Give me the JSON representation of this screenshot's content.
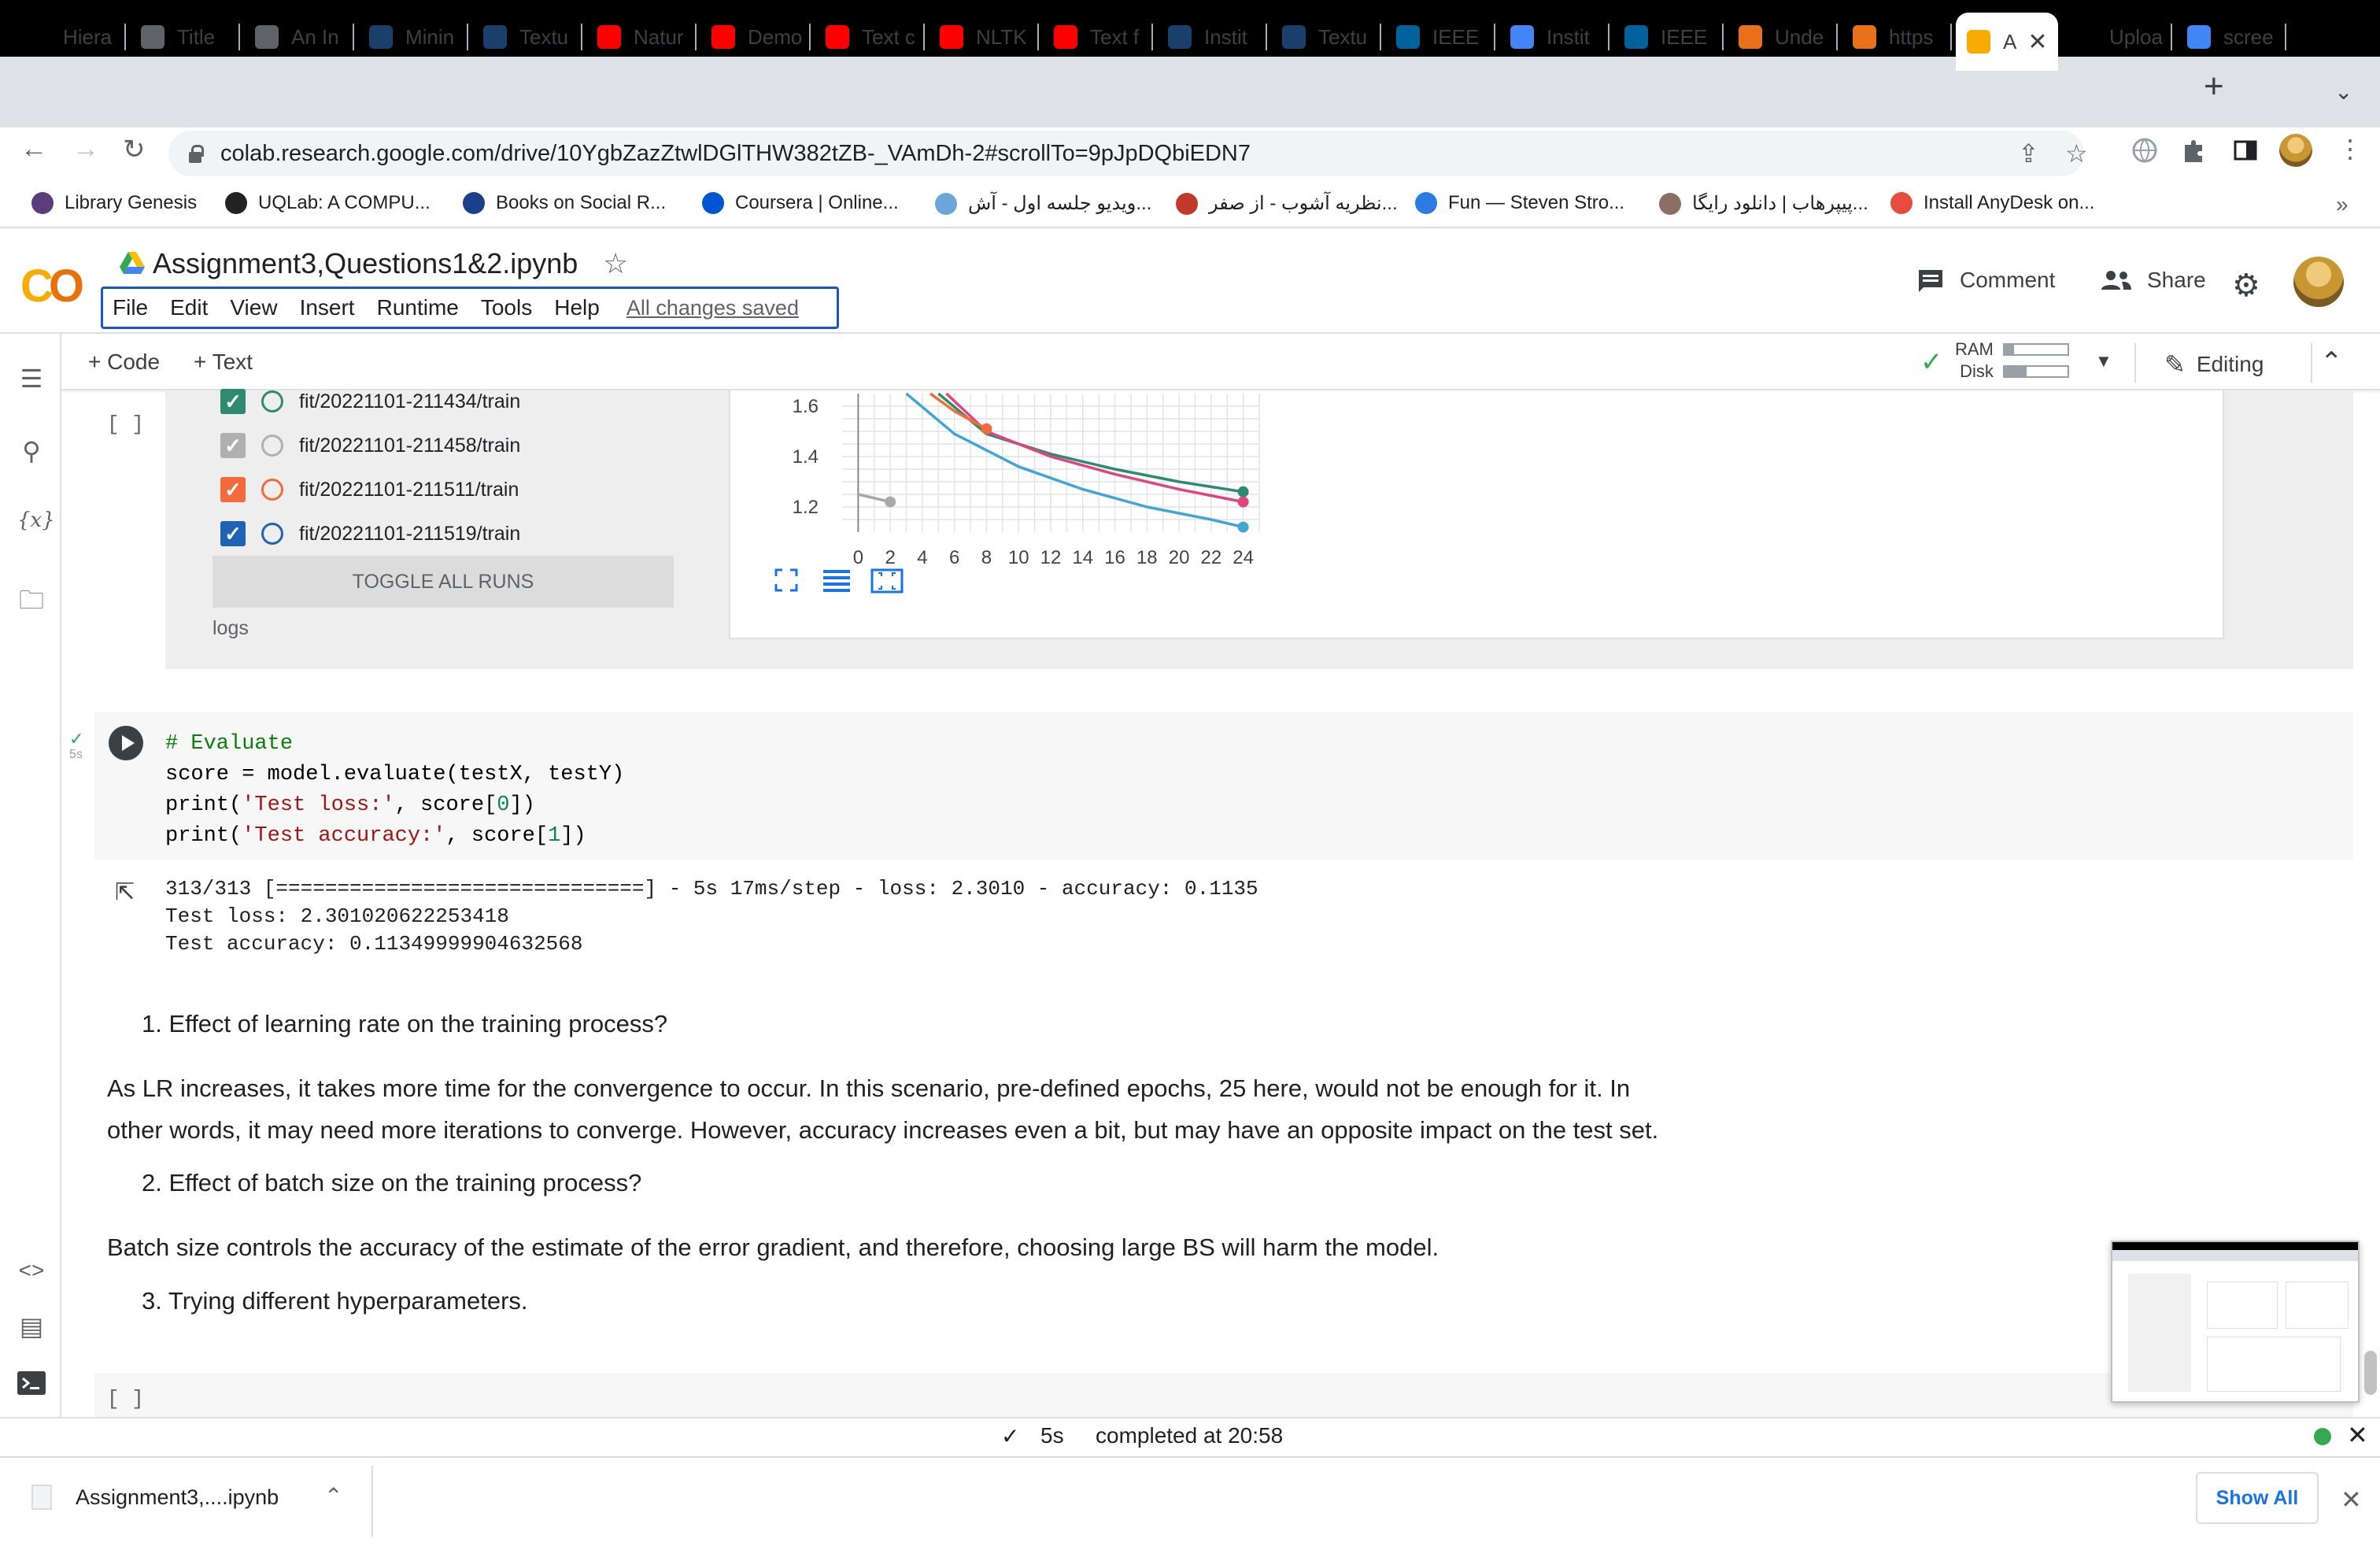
{
  "browser": {
    "tabs": [
      {
        "label": "Hiera",
        "icon": "asu-icon",
        "color": "#000000"
      },
      {
        "label": "Title",
        "icon": "globe-icon",
        "color": "#5f6368"
      },
      {
        "label": "An In",
        "icon": "globe-icon",
        "color": "#5f6368"
      },
      {
        "label": "Minin",
        "icon": "arc-icon",
        "color": "#1b3f6b"
      },
      {
        "label": "Textu",
        "icon": "arc-icon",
        "color": "#1b3f6b"
      },
      {
        "label": "Natur",
        "icon": "youtube-icon",
        "color": "#ff0000"
      },
      {
        "label": "Demo",
        "icon": "youtube-icon",
        "color": "#ff0000"
      },
      {
        "label": "Text c",
        "icon": "youtube-icon",
        "color": "#ff0000"
      },
      {
        "label": "NLTK",
        "icon": "youtube-icon",
        "color": "#ff0000"
      },
      {
        "label": "Text f",
        "icon": "youtube-icon",
        "color": "#ff0000"
      },
      {
        "label": "Instit",
        "icon": "arc-icon",
        "color": "#1b3f6b"
      },
      {
        "label": "Textu",
        "icon": "arc-icon",
        "color": "#1b3f6b"
      },
      {
        "label": "IEEE",
        "icon": "ieee-icon",
        "color": "#00629b"
      },
      {
        "label": "Instit",
        "icon": "chrome-icon",
        "color": "#4285f4"
      },
      {
        "label": "IEEE",
        "icon": "ieee-icon",
        "color": "#00629b"
      },
      {
        "label": "Unde",
        "icon": "elsevier-icon",
        "color": "#e9711c"
      },
      {
        "label": "https",
        "icon": "elsevier-icon",
        "color": "#e9711c"
      },
      {
        "label": "A",
        "icon": "colab-icon",
        "color": "#f9ab00",
        "active": true
      },
      {
        "label": "Uploa",
        "icon": "github-icon",
        "color": "#000000"
      },
      {
        "label": "scree",
        "icon": "google-icon",
        "color": "#4285f4"
      }
    ],
    "url": "colab.research.google.com/drive/10YgbZazZtwlDGlTHW382tZB-_VAmDh-2#scrollTo=9pJpDQbiEDN7",
    "bookmarks": [
      {
        "label": "Library Genesis",
        "color": "#5a3d7a"
      },
      {
        "label": "UQLab: A COMPU...",
        "color": "#222222"
      },
      {
        "label": "Books on Social R...",
        "color": "#1b3f8b"
      },
      {
        "label": "Coursera | Online...",
        "color": "#0056d2"
      },
      {
        "label": "ویدیو جلسه اول - آش...",
        "color": "#6aa6d8"
      },
      {
        "label": "نظریه آشوب - از صفر...",
        "color": "#c0392b"
      },
      {
        "label": "Fun — Steven Stro...",
        "color": "#2c7be5"
      },
      {
        "label": "پیپرهاب | دانلود رایگا...",
        "color": "#8d6e63"
      },
      {
        "label": "Install AnyDesk on...",
        "color": "#e74c3c"
      }
    ]
  },
  "colab": {
    "title": "Assignment3,Questions1&2.ipynb",
    "menu": [
      "File",
      "Edit",
      "View",
      "Insert",
      "Runtime",
      "Tools",
      "Help"
    ],
    "saved": "All changes saved",
    "comment": "Comment",
    "share": "Share",
    "add_code": "+ Code",
    "add_text": "+ Text",
    "ram": "RAM",
    "disk": "Disk",
    "ram_usage": 0.15,
    "disk_usage": 0.35,
    "editing": "Editing"
  },
  "tensorboard": {
    "runs": [
      {
        "label": "fit/20221101-211434/train",
        "checked": true,
        "color": "#2e8b6e"
      },
      {
        "label": "fit/20221101-211458/train",
        "checked": true,
        "color": "#b0b0b0"
      },
      {
        "label": "fit/20221101-211511/train",
        "checked": true,
        "color": "#f26b3a"
      },
      {
        "label": "fit/20221101-211519/train",
        "checked": true,
        "color": "#1f63b5"
      }
    ],
    "toggle_label": "TOGGLE ALL RUNS",
    "logs_label": "logs"
  },
  "chart_data": {
    "type": "line",
    "title": "",
    "xlabel": "",
    "ylabel": "",
    "x_ticks": [
      "0",
      "2",
      "4",
      "6",
      "8",
      "10",
      "12",
      "14",
      "16",
      "18",
      "20",
      "22",
      "24"
    ],
    "y_ticks": [
      "1.2",
      "1.4",
      "1.6"
    ],
    "xlim": [
      -1,
      25
    ],
    "ylim": [
      1.1,
      1.65
    ],
    "series": [
      {
        "color": "#2e8b6e",
        "x": [
          5,
          8,
          12,
          16,
          20,
          24
        ],
        "y": [
          1.65,
          1.49,
          1.41,
          1.35,
          1.3,
          1.26
        ]
      },
      {
        "color": "#e0457b",
        "x": [
          5.5,
          8,
          12,
          16,
          20,
          24
        ],
        "y": [
          1.65,
          1.5,
          1.4,
          1.33,
          1.27,
          1.22
        ]
      },
      {
        "color": "#f26b3a",
        "x": [
          4.5,
          6,
          8
        ],
        "y": [
          1.65,
          1.58,
          1.51
        ]
      },
      {
        "color": "#42a5d8",
        "x": [
          3,
          6,
          10,
          14,
          18,
          22,
          24
        ],
        "y": [
          1.65,
          1.49,
          1.36,
          1.27,
          1.2,
          1.15,
          1.12
        ]
      },
      {
        "color": "#a8a8a8",
        "x": [
          0,
          2
        ],
        "y": [
          1.25,
          1.22
        ]
      }
    ]
  },
  "code_cell": {
    "exec_time": "5s",
    "lines": [
      "# Evaluate",
      "score = model.evaluate(testX, testY)",
      "print('Test loss:', score[0])",
      "print('Test accuracy:', score[1])"
    ]
  },
  "output": {
    "lines": [
      "313/313 [==============================] - 5s 17ms/step - loss: 2.3010 - accuracy: 0.1135",
      "Test loss: 2.301020622253418",
      "Test accuracy: 0.11349999904632568"
    ]
  },
  "markdown": {
    "q1": "1. Effect of learning rate on the training process?",
    "a1_line1": "As LR increases, it takes more time for the convergence to occur. In this scenario, pre-defined epochs, 25 here, would not be enough for it. In",
    "a1_line2": "other words, it may need more iterations to converge. However, accuracy increases even a bit, but may have an opposite impact on the test set.",
    "q2": "2. Effect of batch size on the training process?",
    "a2": "Batch size controls the accuracy of the estimate of the error gradient, and therefore, choosing large BS will harm the model.",
    "q3": "3. Trying different hyperparameters."
  },
  "cell_bracket": "[ ]",
  "status": {
    "time": "5s",
    "completed": "completed at 20:58"
  },
  "downloads": {
    "file": "Assignment3,....ipynb",
    "show_all": "Show All"
  }
}
